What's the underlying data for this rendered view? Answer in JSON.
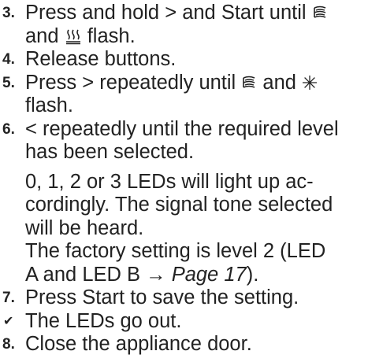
{
  "steps": [
    {
      "number": "3.",
      "line1_before": "Press and hold ",
      "line1_arrow": ">",
      "line1_mid": " and Start until ",
      "line2_before": "and ",
      "line2_after": " flash."
    },
    {
      "number": "4.",
      "text": "Release buttons."
    },
    {
      "number": "5.",
      "line1_before": "Press ",
      "line1_arrow": ">",
      "line1_mid": " repeatedly until ",
      "line1_and": " and ",
      "line2": "flash."
    },
    {
      "number": "6.",
      "line1_arrow": "<",
      "line1_after": " repeatedly until the required level",
      "line2": "has been selected."
    }
  ],
  "notes": {
    "line1": "0, 1, 2 or 3 LEDs will light up ac-",
    "line2": "cordingly. The signal tone selected",
    "line3": "will be heard.",
    "line4": "The factory setting is level 2 (LED",
    "line5_before": "A and LED B → ",
    "line5_link": "Page 17",
    "line5_after": ")."
  },
  "step7": {
    "number": "7.",
    "text": "Press Start to save the setting."
  },
  "result": {
    "check": "✔",
    "text": "The LEDs go out."
  },
  "step8": {
    "number": "8.",
    "text": "Close the appliance door."
  },
  "icons": {
    "rinse": "rinse-symbol-icon",
    "dry": "heating-symbol-icon",
    "star": "asterisk-symbol-icon"
  }
}
